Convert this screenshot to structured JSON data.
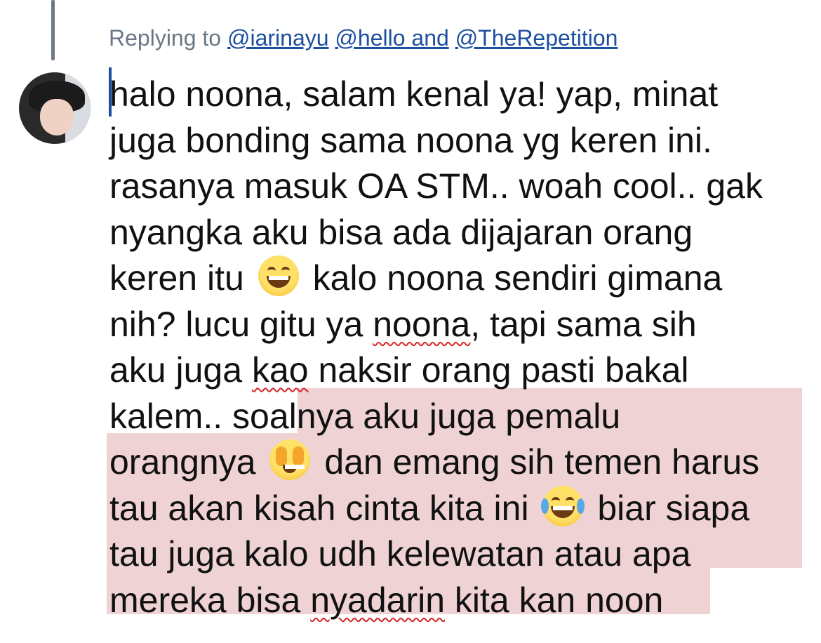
{
  "reply_header": {
    "prefix": "Replying to",
    "mentions": [
      "@iarinayu",
      "@hello and",
      "@TheRepetition"
    ]
  },
  "tweet": {
    "lines": [
      {
        "before": "halo noona, salam kenal ya! yap, minat"
      },
      {
        "before": "juga bonding sama noona yg keren ini."
      },
      {
        "before": "rasanya masuk OA STM.. woah cool.. gak"
      },
      {
        "before": "nyangka aku bisa ada dijajaran orang"
      },
      {
        "before": "keren itu",
        "emoji": "grinning-face",
        "after": "kalo noona sendiri gimana"
      },
      {
        "before": "nih? lucu gitu ya ",
        "mark": "noona",
        "after": ", tapi sama sih"
      },
      {
        "before": "aku juga ",
        "mark": "kao",
        "after": " naksir orang pasti bakal"
      },
      {
        "before": "kalem.. soalnya aku juga pemalu"
      },
      {
        "before": "orangnya",
        "emoji": "face-with-hands-over-eyes",
        "after": "dan emang sih temen harus"
      },
      {
        "before": "tau akan kisah cinta kita ini",
        "emoji": "tears-of-joy",
        "after": "biar siapa"
      },
      {
        "before": "tau juga kalo udh kelewatan atau apa"
      },
      {
        "before": "mereka bisa ",
        "mark": "nyadarin",
        "after": " kita kan noon"
      }
    ]
  },
  "colors": {
    "link": "#1d4fa0",
    "muted": "#6a7785",
    "highlight": "#efd2d3",
    "spellcheck": "#d4262a"
  },
  "icons": [
    "avatar",
    "grinning-face",
    "face-with-hands-over-eyes",
    "tears-of-joy"
  ]
}
